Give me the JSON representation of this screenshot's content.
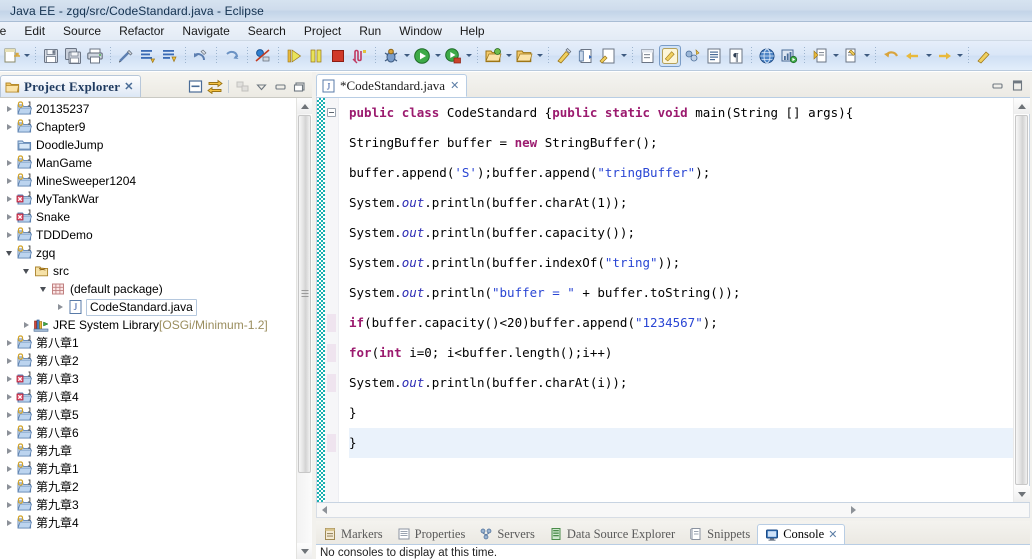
{
  "window": {
    "title": "Java EE - zgq/src/CodeStandard.java - Eclipse"
  },
  "menu": {
    "items": [
      {
        "label": "File",
        "name": "menu-file"
      },
      {
        "label": "Edit",
        "name": "menu-edit"
      },
      {
        "label": "Source",
        "name": "menu-source"
      },
      {
        "label": "Refactor",
        "name": "menu-refactor"
      },
      {
        "label": "Navigate",
        "name": "menu-navigate"
      },
      {
        "label": "Search",
        "name": "menu-search"
      },
      {
        "label": "Project",
        "name": "menu-project"
      },
      {
        "label": "Run",
        "name": "menu-run"
      },
      {
        "label": "Window",
        "name": "menu-window"
      },
      {
        "label": "Help",
        "name": "menu-help"
      }
    ]
  },
  "toolbar": {
    "groups": [
      {
        "buttons": [
          {
            "icon": "new-wizard-icon",
            "arrow": true
          }
        ]
      },
      {
        "buttons": [
          {
            "icon": "save-icon",
            "arrow": false
          },
          {
            "icon": "save-all-icon",
            "arrow": false
          },
          {
            "icon": "print-icon",
            "arrow": false
          }
        ]
      },
      {
        "buttons": [
          {
            "icon": "toggle-mark-occurrences-icon",
            "arrow": false
          },
          {
            "icon": "open-task-icon",
            "arrow": false
          },
          {
            "icon": "toggle-ant-mark-icon",
            "arrow": false
          }
        ]
      },
      {
        "buttons": [
          {
            "icon": "undo-icon",
            "arrow": false
          }
        ]
      },
      {
        "buttons": [
          {
            "icon": "redo-icon",
            "arrow": false
          }
        ]
      },
      {
        "buttons": [
          {
            "icon": "skip-breakpoints-icon",
            "arrow": false
          }
        ]
      },
      {
        "buttons": [
          {
            "icon": "resume-icon",
            "arrow": false
          },
          {
            "icon": "suspend-icon",
            "arrow": false
          },
          {
            "icon": "terminate-icon",
            "arrow": false
          },
          {
            "icon": "disconnect-icon",
            "arrow": false
          }
        ]
      },
      {
        "buttons": [
          {
            "icon": "debug-icon",
            "arrow": true
          },
          {
            "icon": "run-icon",
            "arrow": true
          },
          {
            "icon": "run-external-tools-icon",
            "arrow": true
          }
        ]
      },
      {
        "buttons": [
          {
            "icon": "new-java-project-icon",
            "arrow": true
          },
          {
            "icon": "new-package-icon",
            "arrow": true
          }
        ]
      },
      {
        "buttons": [
          {
            "icon": "open-type-icon",
            "arrow": false
          },
          {
            "icon": "open-task-2-icon",
            "arrow": false
          },
          {
            "icon": "search-pencil-icon",
            "arrow": true
          }
        ]
      },
      {
        "buttons": [
          {
            "icon": "next-annotation-icon",
            "arrow": false
          },
          {
            "icon": "pencil-edit-icon",
            "arrow": false,
            "active": true
          },
          {
            "icon": "link-editor-icon",
            "arrow": false
          },
          {
            "icon": "show-whitespace-icon",
            "arrow": false
          },
          {
            "icon": "pilcrow-icon",
            "arrow": false
          }
        ]
      },
      {
        "buttons": [
          {
            "icon": "web-browser-icon",
            "arrow": false
          },
          {
            "icon": "profile-icon",
            "arrow": false
          }
        ]
      },
      {
        "buttons": [
          {
            "icon": "next-edit-icon",
            "arrow": true
          },
          {
            "icon": "previous-edit-icon",
            "arrow": true
          }
        ]
      },
      {
        "buttons": [
          {
            "icon": "back-icon",
            "arrow": false
          },
          {
            "icon": "forward-left-icon",
            "arrow": true
          },
          {
            "icon": "forward-icon",
            "arrow": true
          }
        ]
      },
      {
        "buttons": [
          {
            "icon": "last-edit-location-icon",
            "arrow": false
          }
        ]
      }
    ]
  },
  "explorer": {
    "tab_label": "Project Explorer",
    "tab_close": "✕",
    "tools": [
      {
        "name": "collapse-all-icon"
      },
      {
        "name": "link-with-editor-icon"
      },
      {
        "name": "view-menu-icon"
      },
      {
        "name": "chevron-down-icon"
      },
      {
        "name": "minimize-icon"
      },
      {
        "name": "maximize-icon"
      }
    ],
    "tree": [
      {
        "label": "20135237",
        "indent": 0,
        "twist": "closed",
        "icon": "java-project-icon",
        "selected": false
      },
      {
        "label": "Chapter9",
        "indent": 0,
        "twist": "closed",
        "icon": "java-project-icon",
        "selected": false
      },
      {
        "label": "DoodleJump",
        "indent": 0,
        "twist": "none",
        "icon": "closed-project-icon",
        "selected": false
      },
      {
        "label": "ManGame",
        "indent": 0,
        "twist": "closed",
        "icon": "java-project-icon",
        "selected": false
      },
      {
        "label": "MineSweeper1204",
        "indent": 0,
        "twist": "closed",
        "icon": "java-project-icon",
        "selected": false
      },
      {
        "label": "MyTankWar",
        "indent": 0,
        "twist": "closed",
        "icon": "java-project-error-icon",
        "selected": false
      },
      {
        "label": "Snake",
        "indent": 0,
        "twist": "closed",
        "icon": "java-project-error-icon",
        "selected": false
      },
      {
        "label": "TDDDemo",
        "indent": 0,
        "twist": "closed",
        "icon": "java-project-icon",
        "selected": false
      },
      {
        "label": "zgq",
        "indent": 0,
        "twist": "open",
        "icon": "java-project-icon",
        "selected": false
      },
      {
        "label": "src",
        "indent": 1,
        "twist": "open",
        "icon": "source-folder-icon",
        "selected": false
      },
      {
        "label": "(default package)",
        "indent": 2,
        "twist": "open",
        "icon": "package-icon",
        "selected": false
      },
      {
        "label": "CodeStandard.java",
        "indent": 3,
        "twist": "closed",
        "icon": "java-file-icon",
        "selected": true
      },
      {
        "label": "JRE System Library",
        "sublabel": " [OSGi/Minimum-1.2]",
        "indent": 1,
        "twist": "closed",
        "icon": "library-icon",
        "selected": false
      },
      {
        "label": "第八章1",
        "indent": 0,
        "twist": "closed",
        "icon": "java-project-icon",
        "selected": false
      },
      {
        "label": "第八章2",
        "indent": 0,
        "twist": "closed",
        "icon": "java-project-icon",
        "selected": false
      },
      {
        "label": "第八章3",
        "indent": 0,
        "twist": "closed",
        "icon": "java-project-error-icon",
        "selected": false
      },
      {
        "label": "第八章4",
        "indent": 0,
        "twist": "closed",
        "icon": "java-project-error-icon",
        "selected": false
      },
      {
        "label": "第八章5",
        "indent": 0,
        "twist": "closed",
        "icon": "java-project-icon",
        "selected": false
      },
      {
        "label": "第八章6",
        "indent": 0,
        "twist": "closed",
        "icon": "java-project-icon",
        "selected": false
      },
      {
        "label": "第九章",
        "indent": 0,
        "twist": "closed",
        "icon": "java-project-icon",
        "selected": false
      },
      {
        "label": "第九章1",
        "indent": 0,
        "twist": "closed",
        "icon": "java-project-icon",
        "selected": false
      },
      {
        "label": "第九章2",
        "indent": 0,
        "twist": "closed",
        "icon": "java-project-icon",
        "selected": false
      },
      {
        "label": "第九章3",
        "indent": 0,
        "twist": "closed",
        "icon": "java-project-icon",
        "selected": false
      },
      {
        "label": "第九章4",
        "indent": 0,
        "twist": "closed",
        "icon": "java-project-icon",
        "selected": false
      }
    ]
  },
  "editor": {
    "tab_label": "*CodeStandard.java",
    "tab_close": "✕",
    "tools": [
      {
        "name": "minimize-icon"
      },
      {
        "name": "maximize-icon"
      }
    ],
    "lines": [
      {
        "fold": "start",
        "tokens": [
          {
            "t": "public ",
            "c": "kw"
          },
          {
            "t": "class ",
            "c": "kw"
          },
          {
            "t": "CodeStandard {",
            "c": "pl"
          },
          {
            "t": "public ",
            "c": "kw"
          },
          {
            "t": "static ",
            "c": "kw"
          },
          {
            "t": "void ",
            "c": "kw"
          },
          {
            "t": "main(String [] args){",
            "c": "pl"
          }
        ]
      },
      {
        "fold": "none",
        "tokens": [
          {
            "t": "StringBuffer buffer = ",
            "c": "pl"
          },
          {
            "t": "new ",
            "c": "kw"
          },
          {
            "t": "StringBuffer();",
            "c": "pl"
          }
        ]
      },
      {
        "fold": "none",
        "tokens": [
          {
            "t": "buffer.append(",
            "c": "pl"
          },
          {
            "t": "'S'",
            "c": "str"
          },
          {
            "t": ");buffer.append(",
            "c": "pl"
          },
          {
            "t": "\"tringBuffer\"",
            "c": "str"
          },
          {
            "t": ");",
            "c": "pl"
          }
        ]
      },
      {
        "fold": "none",
        "tokens": [
          {
            "t": "System.",
            "c": "pl"
          },
          {
            "t": "out",
            "c": "fld"
          },
          {
            "t": ".println(buffer.charAt(1));",
            "c": "pl"
          }
        ]
      },
      {
        "fold": "none",
        "tokens": [
          {
            "t": "System.",
            "c": "pl"
          },
          {
            "t": "out",
            "c": "fld"
          },
          {
            "t": ".println(buffer.capacity());",
            "c": "pl"
          }
        ]
      },
      {
        "fold": "none",
        "tokens": [
          {
            "t": "System.",
            "c": "pl"
          },
          {
            "t": "out",
            "c": "fld"
          },
          {
            "t": ".println(buffer.indexOf(",
            "c": "pl"
          },
          {
            "t": "\"tring\"",
            "c": "str"
          },
          {
            "t": "));",
            "c": "pl"
          }
        ]
      },
      {
        "fold": "none",
        "tokens": [
          {
            "t": "System.",
            "c": "pl"
          },
          {
            "t": "out",
            "c": "fld"
          },
          {
            "t": ".println(",
            "c": "pl"
          },
          {
            "t": "\"buffer = \"",
            "c": "str"
          },
          {
            "t": " + buffer.toString());",
            "c": "pl"
          }
        ]
      },
      {
        "fold": "none",
        "tokens": [
          {
            "t": "if",
            "c": "kw"
          },
          {
            "t": "(buffer.capacity()<20)buffer.append(",
            "c": "pl"
          },
          {
            "t": "\"1234567\"",
            "c": "str"
          },
          {
            "t": ");",
            "c": "pl"
          }
        ]
      },
      {
        "fold": "none",
        "tokens": [
          {
            "t": "for",
            "c": "kw"
          },
          {
            "t": "(",
            "c": "pl"
          },
          {
            "t": "int ",
            "c": "kw"
          },
          {
            "t": "i=0; i<buffer.length();i++)",
            "c": "pl"
          }
        ]
      },
      {
        "fold": "none",
        "tokens": [
          {
            "t": "System.",
            "c": "pl"
          },
          {
            "t": "out",
            "c": "fld"
          },
          {
            "t": ".println(buffer.charAt(i));",
            "c": "pl"
          }
        ]
      },
      {
        "fold": "none",
        "tokens": [
          {
            "t": "}",
            "c": "pl"
          }
        ]
      },
      {
        "fold": "none",
        "current": true,
        "tokens": [
          {
            "t": "}",
            "c": "pl"
          }
        ]
      }
    ]
  },
  "bottom_view": {
    "tabs": [
      {
        "label": "Markers",
        "icon": "markers-icon",
        "active": false
      },
      {
        "label": "Properties",
        "icon": "properties-icon",
        "active": false
      },
      {
        "label": "Servers",
        "icon": "servers-icon",
        "active": false
      },
      {
        "label": "Data Source Explorer",
        "icon": "data-source-icon",
        "active": false
      },
      {
        "label": "Snippets",
        "icon": "snippets-icon",
        "active": false
      },
      {
        "label": "Console",
        "icon": "console-icon",
        "active": true,
        "close": "✕"
      }
    ],
    "content": "No consoles to display at this time."
  },
  "colors": {
    "keyword": "#9b1a6e",
    "string": "#2a46d4",
    "field": "#2d2db5",
    "change_bar": "#1ab0b0",
    "current_line": "#eaf2fb",
    "title_bar": "#cfdcec"
  }
}
